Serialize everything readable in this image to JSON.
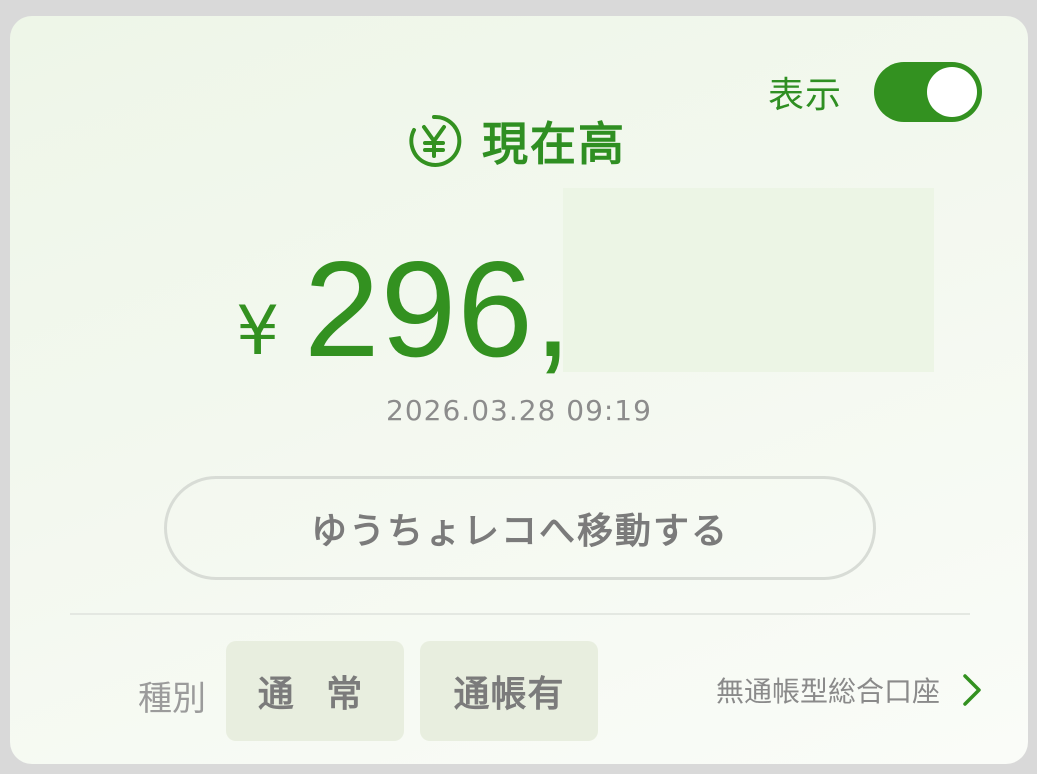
{
  "toggle": {
    "label": "表示",
    "state": true
  },
  "balance": {
    "title": "現在高",
    "icon": "yen-circle-icon",
    "currency_symbol": "¥",
    "amount_visible": "296,",
    "timestamp": "2026.03.28 09:19"
  },
  "actions": {
    "move_button_label": "ゆうちょレコへ移動する"
  },
  "account": {
    "type_label": "種別",
    "chips": [
      "通 常",
      "通帳有"
    ],
    "link_label": "無通帳型総合口座",
    "link_icon": "chevron-right-icon"
  },
  "colors": {
    "accent": "#339120",
    "muted_text": "#8c8c8c",
    "chip_bg": "#e8eedf"
  }
}
